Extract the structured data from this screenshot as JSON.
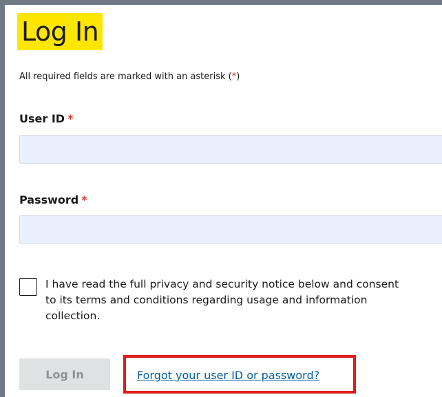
{
  "page": {
    "title": "Log In",
    "required_note": {
      "prefix": "All required fields are marked with an asterisk (",
      "asterisk": "*",
      "suffix": ")"
    }
  },
  "form": {
    "user_id": {
      "label": "User ID",
      "required_marker": "*",
      "value": "",
      "placeholder": ""
    },
    "password": {
      "label": "Password",
      "required_marker": "*",
      "value": "",
      "placeholder": ""
    },
    "consent": {
      "checked": false,
      "text": "I have read the full privacy and security notice below and consent to its terms and conditions regarding usage and information collection."
    },
    "login_button": {
      "label": "Log In",
      "enabled": false
    },
    "forgot_link": {
      "label": "Forgot your user ID or password?"
    }
  },
  "colors": {
    "title_highlight": "#ffe600",
    "asterisk": "#d83933",
    "input_background": "#e8f0fe",
    "link": "#005ea2",
    "annotation_box": "#e21b1b",
    "disabled_button": "#dfe1e2",
    "frame_border": "#6f7a86"
  },
  "annotation": {
    "highlighted_element": "forgot-password-link"
  }
}
